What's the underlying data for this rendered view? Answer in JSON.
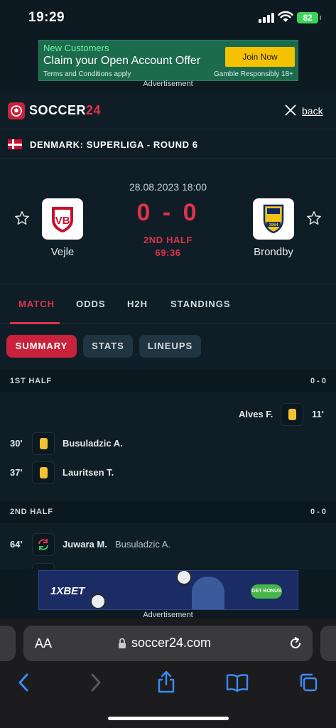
{
  "status_bar": {
    "time": "19:29",
    "battery": "82"
  },
  "ad_top": {
    "headline": "New Customers",
    "offer": "Claim your Open Account Offer",
    "terms": "Terms and Conditions apply",
    "responsible": "Gamble Responsibly 18+",
    "cta": "Join Now",
    "label": "Advertisement"
  },
  "header": {
    "logo": "SOCCER",
    "logo_num": "24",
    "back": "back"
  },
  "league": {
    "name": "DENMARK: SUPERLIGA - ROUND 6"
  },
  "match": {
    "datetime": "28.08.2023 18:00",
    "home": {
      "name": "Vejle",
      "crest_text": "VB"
    },
    "away": {
      "name": "Brondby",
      "crest_text": "1964"
    },
    "score": "0 - 0",
    "period": "2ND HALF",
    "clock": "69:36"
  },
  "tabs": [
    "MATCH",
    "ODDS",
    "H2H",
    "STANDINGS"
  ],
  "subtabs": [
    "SUMMARY",
    "STATS",
    "LINEUPS"
  ],
  "first_half": {
    "label": "1ST HALF",
    "score": "0 - 0",
    "events": [
      {
        "minute": "11'",
        "player": "Alves F.",
        "side": "away",
        "type": "yellow-card"
      },
      {
        "minute": "30'",
        "player": "Busuladzic A.",
        "side": "home",
        "type": "yellow-card"
      },
      {
        "minute": "37'",
        "player": "Lauritsen T.",
        "side": "home",
        "type": "yellow-card"
      }
    ]
  },
  "second_half": {
    "label": "2ND HALF",
    "score": "0 - 0",
    "events": [
      {
        "minute": "64'",
        "player": "Juwara M.",
        "sub_out": "Busuladzic A.",
        "side": "home",
        "type": "substitution"
      }
    ]
  },
  "ad_bottom": {
    "brand": "1XBET",
    "cta": "GET BONUS",
    "label": "Advertisement"
  },
  "browser": {
    "aa": "AA",
    "url": "soccer24.com"
  },
  "colors": {
    "accent": "#e0324b",
    "card": "#f1c232",
    "background": "#0f1e26"
  }
}
